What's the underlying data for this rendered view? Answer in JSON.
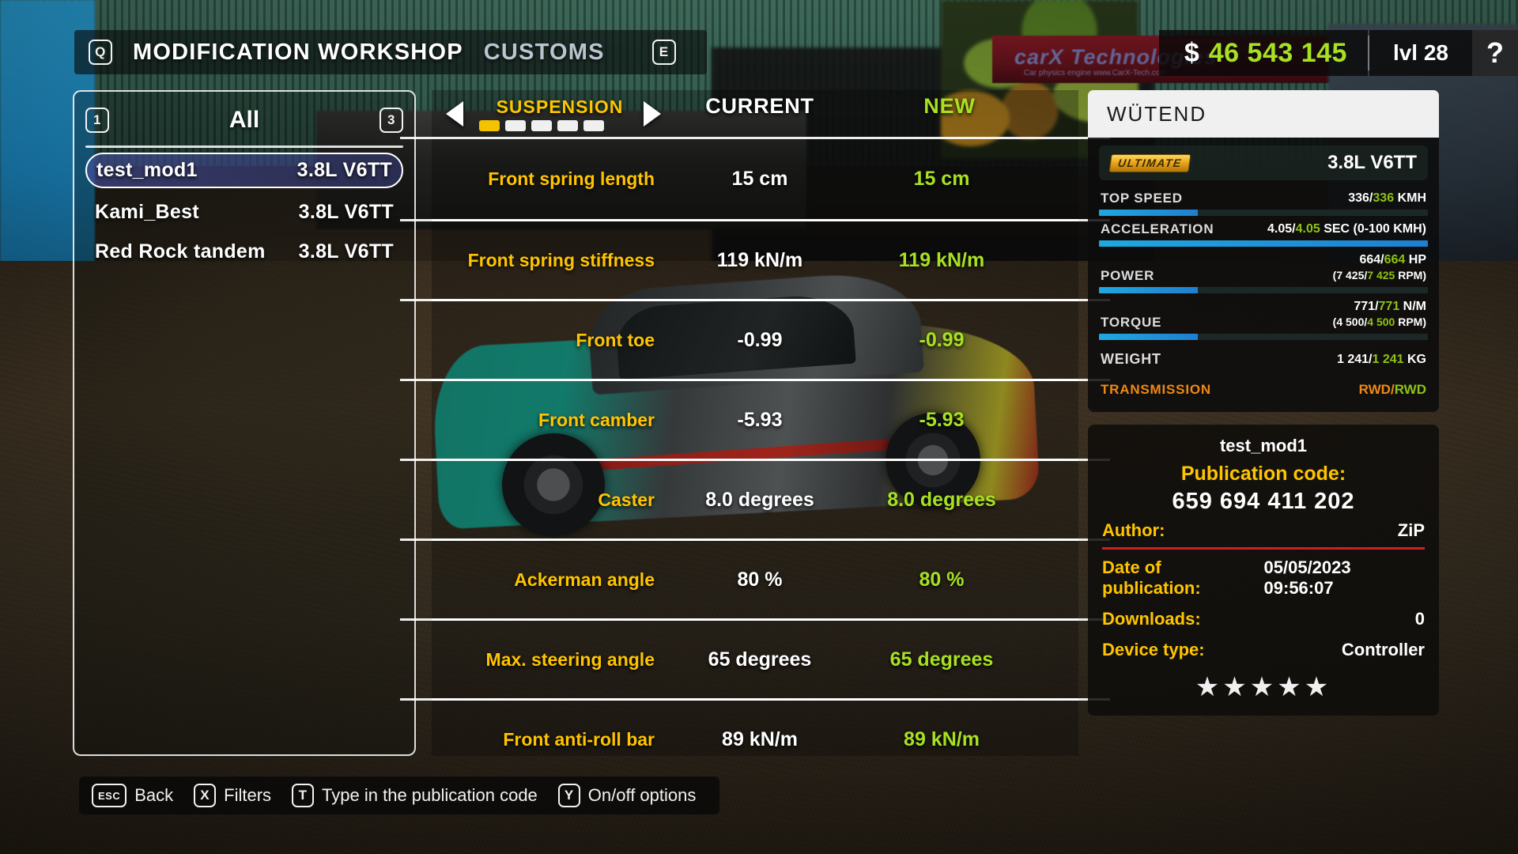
{
  "nav": {
    "left_key": "Q",
    "right_key": "E",
    "active_tab": "MODIFICATION WORKSHOP",
    "inactive_tab": "CUSTOMS"
  },
  "hud": {
    "currency_symbol": "$",
    "money": "46 543 145",
    "level": "lvl 28",
    "help": "?",
    "money_color": "#a7e122"
  },
  "background": {
    "banner_text": "carX Technologies",
    "banner_sub": "Car physics engine   www.CarX-Tech.com"
  },
  "mod_list": {
    "prev_key": "1",
    "next_key": "3",
    "filter_label": "All",
    "items": [
      {
        "name": "test_mod1",
        "engine": "3.8L V6TT",
        "selected": true
      },
      {
        "name": "Kami_Best",
        "engine": "3.8L V6TT",
        "selected": false
      },
      {
        "name": "Red Rock tandem",
        "engine": "3.8L V6TT",
        "selected": false
      }
    ]
  },
  "tuning": {
    "category": "SUSPENSION",
    "page_index": 0,
    "page_count": 5,
    "column_current": "CURRENT",
    "column_new": "NEW",
    "rows": [
      {
        "label": "Front spring length",
        "current": "15 cm",
        "new": "15 cm"
      },
      {
        "label": "Front spring stiffness",
        "current": "119 kN/m",
        "new": "119 kN/m"
      },
      {
        "label": "Front toe",
        "current": "-0.99",
        "new": "-0.99"
      },
      {
        "label": "Front camber",
        "current": "-5.93",
        "new": "-5.93"
      },
      {
        "label": "Caster",
        "current": "8.0 degrees",
        "new": "8.0 degrees"
      },
      {
        "label": "Ackerman angle",
        "current": "80 %",
        "new": "80 %"
      },
      {
        "label": "Max. steering angle",
        "current": "65 degrees",
        "new": "65 degrees"
      },
      {
        "label": "Front anti-roll bar",
        "current": "89 kN/m",
        "new": "89 kN/m"
      }
    ]
  },
  "car": {
    "name": "WÜTEND",
    "class_badge": "ULTIMATE",
    "engine": "3.8L V6TT",
    "stats": [
      {
        "name": "TOP SPEED",
        "current": "336",
        "new": "336",
        "unit": "KMH",
        "sub": "",
        "fill_pct": 30
      },
      {
        "name": "ACCELERATION",
        "current": "4.05",
        "new": "4.05",
        "unit": "SEC (0-100 KMH)",
        "sub": "",
        "fill_pct": 100
      },
      {
        "name": "POWER",
        "current": "664",
        "new": "664",
        "unit": "HP",
        "sub": "(7 425/7 425 RPM)",
        "sub_current": "7 425",
        "sub_new": "7 425",
        "fill_pct": 30
      },
      {
        "name": "TORQUE",
        "current": "771",
        "new": "771",
        "unit": "N/M",
        "sub": "(4 500/4 500 RPM)",
        "sub_current": "4 500",
        "sub_new": "4 500",
        "fill_pct": 30
      }
    ],
    "weight": {
      "name": "WEIGHT",
      "current": "1 241",
      "new": "1 241",
      "unit": "KG"
    },
    "transmission": {
      "name": "TRANSMISSION",
      "current": "RWD",
      "new": "RWD"
    }
  },
  "publication": {
    "mod_name": "test_mod1",
    "code_label": "Publication code:",
    "code": "659 694 411 202",
    "author_label": "Author:",
    "author": "ZiP",
    "date_label": "Date of publication:",
    "date": "05/05/2023 09:56:07",
    "downloads_label": "Downloads:",
    "downloads": "0",
    "device_label": "Device type:",
    "device": "Controller",
    "rating": "★★★★★"
  },
  "hints": [
    {
      "key": "ESC",
      "label": "Back"
    },
    {
      "key": "X",
      "label": "Filters"
    },
    {
      "key": "T",
      "label": "Type in the publication code"
    },
    {
      "key": "Y",
      "label": "On/off options"
    }
  ]
}
